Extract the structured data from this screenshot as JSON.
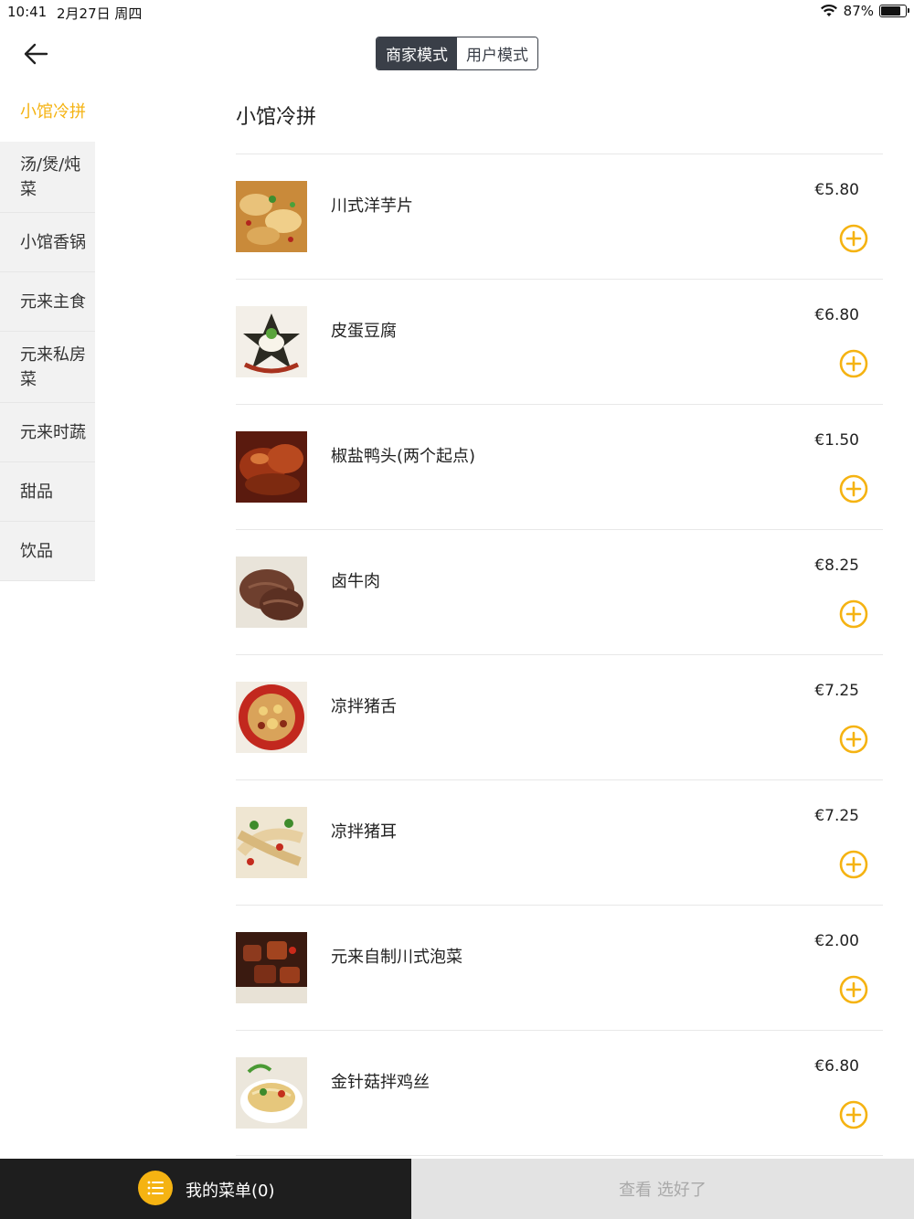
{
  "status_bar": {
    "time": "10:41",
    "date": "2月27日 周四",
    "battery": "87%",
    "battery_level": 0.87
  },
  "header": {
    "mode_merchant": "商家模式",
    "mode_user": "用户模式",
    "active_mode": "merchant"
  },
  "sidebar": {
    "items": [
      {
        "label": "小馆冷拼",
        "active": true
      },
      {
        "label": "汤/煲/炖菜"
      },
      {
        "label": "小馆香锅"
      },
      {
        "label": "元来主食"
      },
      {
        "label": "元来私房菜"
      },
      {
        "label": "元来时蔬"
      },
      {
        "label": "甜品"
      },
      {
        "label": "饮品"
      }
    ]
  },
  "main": {
    "section_title": "小馆冷拼",
    "dishes": [
      {
        "name": "川式洋芋片",
        "price": "€5.80"
      },
      {
        "name": "皮蛋豆腐",
        "price": "€6.80"
      },
      {
        "name": "椒盐鸭头(两个起点)",
        "price": "€1.50"
      },
      {
        "name": "卤牛肉",
        "price": "€8.25"
      },
      {
        "name": "凉拌猪舌",
        "price": "€7.25"
      },
      {
        "name": "凉拌猪耳",
        "price": "€7.25"
      },
      {
        "name": "元来自制川式泡菜",
        "price": "€2.00"
      },
      {
        "name": "金针菇拌鸡丝",
        "price": "€6.80"
      }
    ]
  },
  "bottom_bar": {
    "my_menu": "我的菜单(0)",
    "checkout": "查看 选好了"
  },
  "colors": {
    "accent": "#f5b312",
    "dark": "#3a3f48",
    "bottom_dark": "#1e1e1e",
    "bottom_light": "#e3e3e3"
  }
}
